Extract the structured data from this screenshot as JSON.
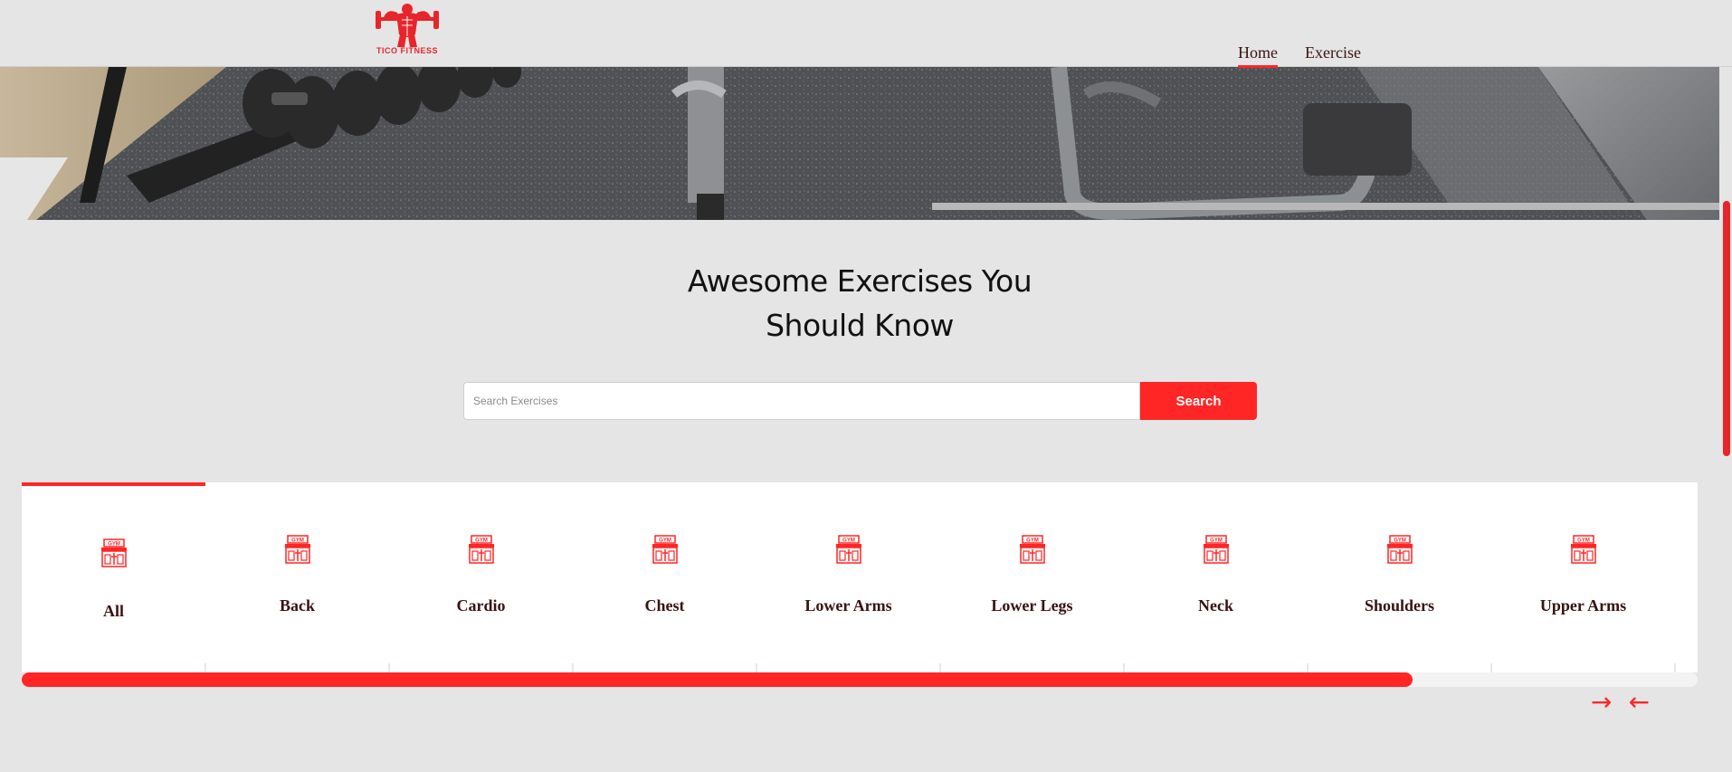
{
  "brand": {
    "logo_text": "TICO FITNESS",
    "accent_color": "#ff2625"
  },
  "nav": {
    "items": [
      {
        "label": "Home",
        "active": true
      },
      {
        "label": "Exercise",
        "active": false
      }
    ]
  },
  "hero": {
    "image": "gym-equipment-banner"
  },
  "main": {
    "title_line1": "Awesome Exercises You",
    "title_line2": "Should Know"
  },
  "search": {
    "placeholder": "Search Exercises",
    "value": "",
    "button_label": "Search"
  },
  "categories": {
    "icon": "gym-icon",
    "items": [
      {
        "label": "All",
        "active": true
      },
      {
        "label": "Back",
        "active": false
      },
      {
        "label": "Cardio",
        "active": false
      },
      {
        "label": "Chest",
        "active": false
      },
      {
        "label": "Lower Arms",
        "active": false
      },
      {
        "label": "Lower Legs",
        "active": false
      },
      {
        "label": "Neck",
        "active": false
      },
      {
        "label": "Shoulders",
        "active": false
      },
      {
        "label": "Upper Arms",
        "active": false
      }
    ],
    "scroll_progress": 0.83
  },
  "slider": {
    "next_icon": "arrow-right-icon",
    "prev_icon": "arrow-left-icon",
    "next_glyph": "→",
    "prev_glyph": "←"
  }
}
